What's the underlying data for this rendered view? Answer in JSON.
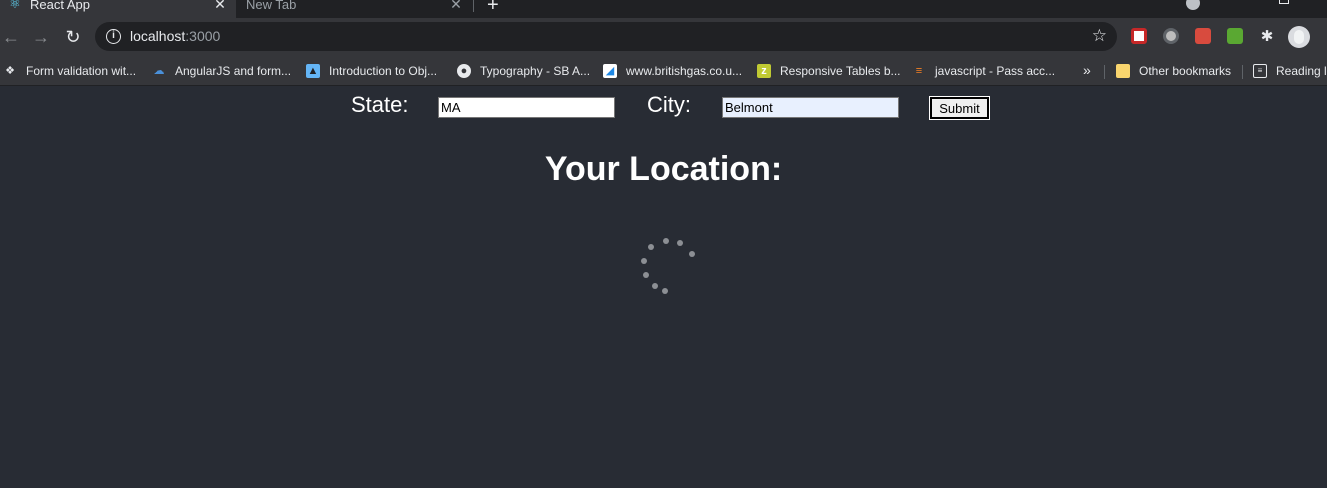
{
  "browser": {
    "tabs": [
      {
        "title": "React App",
        "active": true,
        "favicon": "react-icon"
      },
      {
        "title": "New Tab",
        "active": false
      }
    ],
    "new_tab_label": "+",
    "address_bar": {
      "host": "localhost",
      "port": ":3000"
    },
    "bookmarks": [
      {
        "label": "Form validation wit...",
        "icon": "codepen-icon"
      },
      {
        "label": "AngularJS and form...",
        "icon": "cloud-icon"
      },
      {
        "label": "Introduction to Obj...",
        "icon": "bird-icon"
      },
      {
        "label": "Typography - SB A...",
        "icon": "globe-icon"
      },
      {
        "label": "www.britishgas.co.u...",
        "icon": "britishgas-icon"
      },
      {
        "label": "Responsive Tables b...",
        "icon": "zeroheight-icon"
      },
      {
        "label": "javascript - Pass acc...",
        "icon": "stackoverflow-icon"
      }
    ],
    "bookmarks_overflow": "»",
    "other_bookmarks": "Other bookmarks",
    "reading_list": "Reading l"
  },
  "form": {
    "state_label": "State:",
    "state_value": "MA",
    "city_label": "City:",
    "city_value": "Belmont",
    "submit_label": "Submit"
  },
  "heading": "Your Location:",
  "status": {
    "loading": true,
    "indicator": "spinner-icon"
  },
  "colors": {
    "page_bg": "#282c34",
    "chrome_bg": "#35363a",
    "text": "#ffffff",
    "autofill_bg": "#e8f0fe"
  }
}
